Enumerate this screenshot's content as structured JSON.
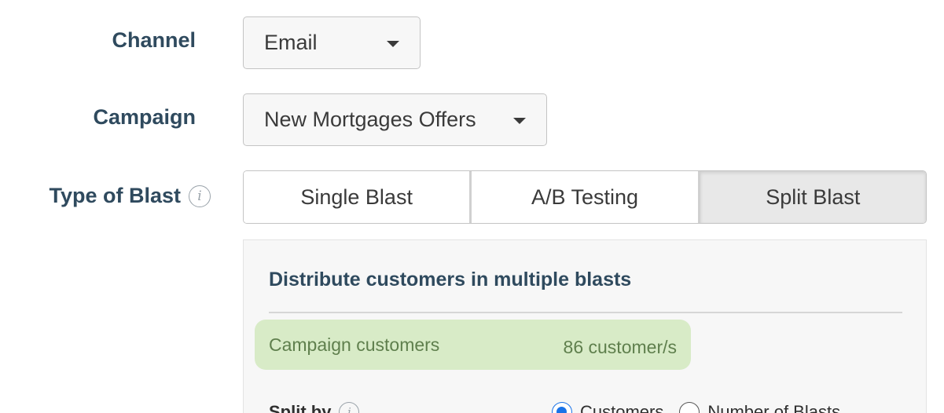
{
  "form": {
    "channel": {
      "label": "Channel",
      "value": "Email"
    },
    "campaign": {
      "label": "Campaign",
      "value": "New Mortgages Offers"
    },
    "blast_type": {
      "label": "Type of Blast",
      "options": [
        "Single Blast",
        "A/B Testing",
        "Split Blast"
      ],
      "selected": "Split Blast"
    }
  },
  "split_panel": {
    "title": "Distribute customers in multiple blasts",
    "summary_label": "Campaign customers",
    "summary_count": "86 customer/s",
    "split_by_label": "Split by",
    "split_options": [
      "Customers",
      "Number of Blasts"
    ],
    "split_selected": "Customers"
  },
  "icons": {
    "info": "info-icon",
    "dropdown": "chevron-down-icon",
    "radio": "radio-icon"
  },
  "colors": {
    "label": "#2f4a5e",
    "summary_bg": "#d8ebc7",
    "summary_text": "#5f7f4d",
    "radio_accent": "#1a73e8"
  }
}
